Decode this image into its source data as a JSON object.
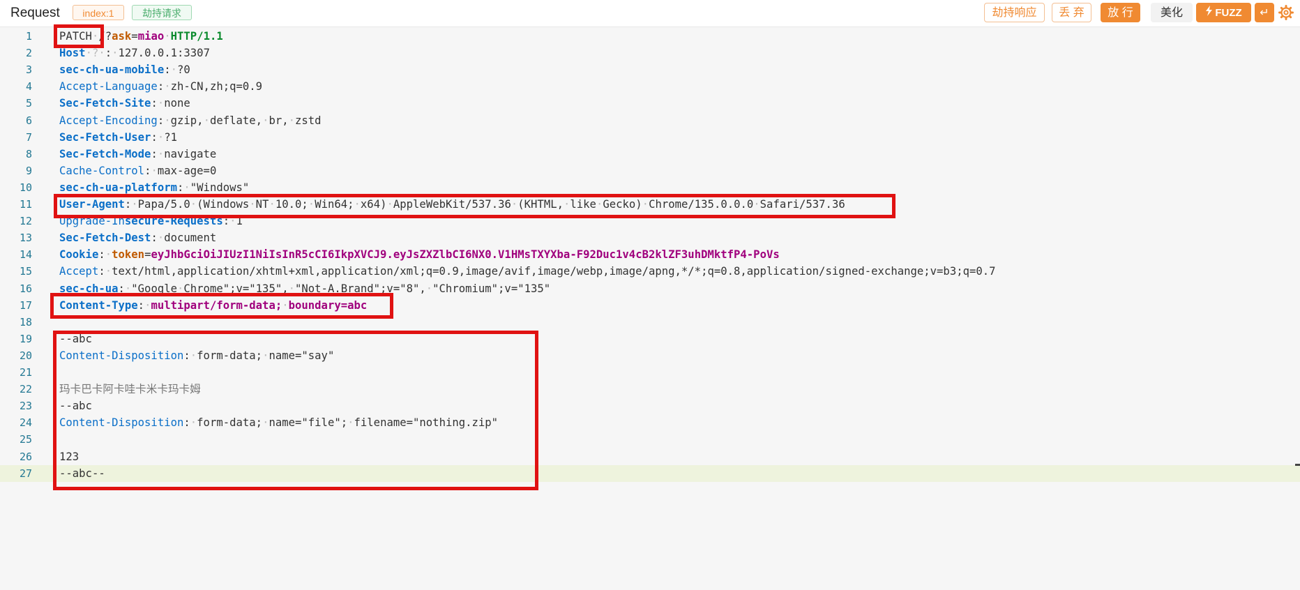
{
  "header": {
    "title": "Request",
    "index_tag": "index:1",
    "hijack_tag": "劫持请求",
    "buttons": {
      "hijack_response": "劫持响应",
      "discard": "丢 弃",
      "release": "放 行",
      "beautify": "美化",
      "fuzz": "FUZZ",
      "wrap": "↵"
    },
    "colors": {
      "accent": "#f08a32",
      "green_tag": "#4cae6e",
      "highlight_box": "#e01212"
    },
    "icons": [
      "bolt-icon",
      "wrap-icon",
      "gear-icon"
    ]
  },
  "editor": {
    "lines": [
      {
        "n": "1",
        "segs": [
          {
            "t": "PATCH",
            "c": ""
          },
          {
            "t": "·",
            "c": "mark"
          },
          {
            "t": "/?",
            "c": ""
          },
          {
            "t": "ask",
            "c": "key"
          },
          {
            "t": "=",
            "c": ""
          },
          {
            "t": "miao",
            "c": "kw"
          },
          {
            "t": "·",
            "c": "mark"
          },
          {
            "t": "HTTP/1.1",
            "c": "proto"
          }
        ]
      },
      {
        "n": "2",
        "segs": [
          {
            "t": "Host",
            "c": "hdrb"
          },
          {
            "t": "·?·",
            "c": "mark"
          },
          {
            "t": ":",
            "c": ""
          },
          {
            "t": "·",
            "c": "mark"
          },
          {
            "t": "127.0.0.1:3307",
            "c": ""
          }
        ]
      },
      {
        "n": "3",
        "segs": [
          {
            "t": "sec-ch-ua-mobile",
            "c": "hdrb"
          },
          {
            "t": ":",
            "c": ""
          },
          {
            "t": "·",
            "c": "mark"
          },
          {
            "t": "?0",
            "c": ""
          }
        ]
      },
      {
        "n": "4",
        "segs": [
          {
            "t": "Accept-Language",
            "c": "hdr"
          },
          {
            "t": ":",
            "c": ""
          },
          {
            "t": "·",
            "c": "mark"
          },
          {
            "t": "zh-CN,zh;q=0.9",
            "c": ""
          }
        ]
      },
      {
        "n": "5",
        "segs": [
          {
            "t": "Sec-Fetch-Site",
            "c": "hdrb"
          },
          {
            "t": ":",
            "c": ""
          },
          {
            "t": "·",
            "c": "mark"
          },
          {
            "t": "none",
            "c": ""
          }
        ]
      },
      {
        "n": "6",
        "segs": [
          {
            "t": "Accept-Encoding",
            "c": "hdr"
          },
          {
            "t": ":",
            "c": ""
          },
          {
            "t": "·",
            "c": "mark"
          },
          {
            "t": "gzip,",
            "c": ""
          },
          {
            "t": "·",
            "c": "mark"
          },
          {
            "t": "deflate,",
            "c": ""
          },
          {
            "t": "·",
            "c": "mark"
          },
          {
            "t": "br,",
            "c": ""
          },
          {
            "t": "·",
            "c": "mark"
          },
          {
            "t": "zstd",
            "c": ""
          }
        ]
      },
      {
        "n": "7",
        "segs": [
          {
            "t": "Sec-Fetch-User",
            "c": "hdrb"
          },
          {
            "t": ":",
            "c": ""
          },
          {
            "t": "·",
            "c": "mark"
          },
          {
            "t": "?1",
            "c": ""
          }
        ]
      },
      {
        "n": "8",
        "segs": [
          {
            "t": "Sec-Fetch-Mode",
            "c": "hdrb"
          },
          {
            "t": ":",
            "c": ""
          },
          {
            "t": "·",
            "c": "mark"
          },
          {
            "t": "navigate",
            "c": ""
          }
        ]
      },
      {
        "n": "9",
        "segs": [
          {
            "t": "Cache-Control",
            "c": "hdr"
          },
          {
            "t": ":",
            "c": ""
          },
          {
            "t": "·",
            "c": "mark"
          },
          {
            "t": "max-age=0",
            "c": ""
          }
        ]
      },
      {
        "n": "10",
        "segs": [
          {
            "t": "sec-ch-ua-platform",
            "c": "hdrb"
          },
          {
            "t": ":",
            "c": ""
          },
          {
            "t": "·",
            "c": "mark"
          },
          {
            "t": "\"Windows\"",
            "c": ""
          }
        ]
      },
      {
        "n": "11",
        "segs": [
          {
            "t": "User-Agent",
            "c": "hdrb"
          },
          {
            "t": ":",
            "c": ""
          },
          {
            "t": "·",
            "c": "mark"
          },
          {
            "t": "Papa/5.0",
            "c": ""
          },
          {
            "t": "·",
            "c": "mark"
          },
          {
            "t": "(Windows",
            "c": ""
          },
          {
            "t": "·",
            "c": "mark"
          },
          {
            "t": "NT",
            "c": ""
          },
          {
            "t": "·",
            "c": "mark"
          },
          {
            "t": "10.0;",
            "c": ""
          },
          {
            "t": "·",
            "c": "mark"
          },
          {
            "t": "Win64;",
            "c": ""
          },
          {
            "t": "·",
            "c": "mark"
          },
          {
            "t": "x64)",
            "c": ""
          },
          {
            "t": "·",
            "c": "mark"
          },
          {
            "t": "AppleWebKit/537.36",
            "c": ""
          },
          {
            "t": "·",
            "c": "mark"
          },
          {
            "t": "(KHTML,",
            "c": ""
          },
          {
            "t": "·",
            "c": "mark"
          },
          {
            "t": "like",
            "c": ""
          },
          {
            "t": "·",
            "c": "mark"
          },
          {
            "t": "Gecko)",
            "c": ""
          },
          {
            "t": "·",
            "c": "mark"
          },
          {
            "t": "Chrome/135.0.0.0",
            "c": ""
          },
          {
            "t": "·",
            "c": "mark"
          },
          {
            "t": "Safari/537.36",
            "c": ""
          }
        ]
      },
      {
        "n": "12",
        "segs": [
          {
            "t": "Upgrade-In",
            "c": "hdr"
          },
          {
            "t": "secure-Requests",
            "c": "hdrb"
          },
          {
            "t": ":",
            "c": ""
          },
          {
            "t": "·",
            "c": "mark"
          },
          {
            "t": "1",
            "c": ""
          }
        ]
      },
      {
        "n": "13",
        "segs": [
          {
            "t": "Sec-Fetch-Dest",
            "c": "hdrb"
          },
          {
            "t": ":",
            "c": ""
          },
          {
            "t": "·",
            "c": "mark"
          },
          {
            "t": "document",
            "c": ""
          }
        ]
      },
      {
        "n": "14",
        "segs": [
          {
            "t": "Cookie",
            "c": "hdrb"
          },
          {
            "t": ":",
            "c": ""
          },
          {
            "t": "·",
            "c": "mark"
          },
          {
            "t": "token",
            "c": "key"
          },
          {
            "t": "=",
            "c": ""
          },
          {
            "t": "eyJhbGciOiJIUzI1NiIsInR5cCI6IkpXVCJ9.eyJsZXZlbCI6NX0.V1HMsTXYXba-F92Duc1v4cB2klZF3uhDMktfP4-PoVs",
            "c": "kw"
          }
        ]
      },
      {
        "n": "15",
        "segs": [
          {
            "t": "Accept",
            "c": "hdr"
          },
          {
            "t": ":",
            "c": ""
          },
          {
            "t": "·",
            "c": "mark"
          },
          {
            "t": "text/html,application/xhtml+xml,application/xml;q=0.9,image/avif,image/webp,image/apng,*/*;q=0.8,application/signed-exchange;v=b3;q=0.7",
            "c": ""
          }
        ]
      },
      {
        "n": "16",
        "segs": [
          {
            "t": "sec-ch-ua",
            "c": "hdrb"
          },
          {
            "t": ":",
            "c": ""
          },
          {
            "t": "·",
            "c": "mark"
          },
          {
            "t": "\"Google",
            "c": ""
          },
          {
            "t": "·",
            "c": "mark"
          },
          {
            "t": "Chrome\";v=\"135\",",
            "c": ""
          },
          {
            "t": "·",
            "c": "mark"
          },
          {
            "t": "\"Not-A.Brand\";v=\"8\",",
            "c": ""
          },
          {
            "t": "·",
            "c": "mark"
          },
          {
            "t": "\"Chromium\";v=\"135\"",
            "c": ""
          }
        ]
      },
      {
        "n": "17",
        "segs": [
          {
            "t": "Content-Type",
            "c": "hdrb"
          },
          {
            "t": ":",
            "c": ""
          },
          {
            "t": "·",
            "c": "mark"
          },
          {
            "t": "multipart/form-data;",
            "c": "kw"
          },
          {
            "t": "·",
            "c": "mark"
          },
          {
            "t": "boundary=abc",
            "c": "kw"
          }
        ]
      },
      {
        "n": "18",
        "segs": []
      },
      {
        "n": "19",
        "segs": [
          {
            "t": "--abc",
            "c": ""
          }
        ]
      },
      {
        "n": "20",
        "segs": [
          {
            "t": "Content-Disposition",
            "c": "hdr"
          },
          {
            "t": ":",
            "c": ""
          },
          {
            "t": "·",
            "c": "mark"
          },
          {
            "t": "form-data;",
            "c": ""
          },
          {
            "t": "·",
            "c": "mark"
          },
          {
            "t": "name=\"say\"",
            "c": ""
          }
        ]
      },
      {
        "n": "21",
        "segs": []
      },
      {
        "n": "22",
        "segs": [
          {
            "t": "玛卡巴卡阿卡哇卡米卡玛卡姆",
            "c": "muted"
          }
        ]
      },
      {
        "n": "23",
        "segs": [
          {
            "t": "--abc",
            "c": ""
          }
        ]
      },
      {
        "n": "24",
        "segs": [
          {
            "t": "Content-Disposition",
            "c": "hdr"
          },
          {
            "t": ":",
            "c": ""
          },
          {
            "t": "·",
            "c": "mark"
          },
          {
            "t": "form-data;",
            "c": ""
          },
          {
            "t": "·",
            "c": "mark"
          },
          {
            "t": "name=\"file\";",
            "c": ""
          },
          {
            "t": "·",
            "c": "mark"
          },
          {
            "t": "filename=\"nothing.zip\"",
            "c": ""
          }
        ]
      },
      {
        "n": "25",
        "segs": []
      },
      {
        "n": "26",
        "segs": [
          {
            "t": "123",
            "c": ""
          }
        ]
      },
      {
        "n": "27",
        "segs": [
          {
            "t": "--abc--",
            "c": ""
          }
        ]
      }
    ],
    "current_line": "27"
  }
}
